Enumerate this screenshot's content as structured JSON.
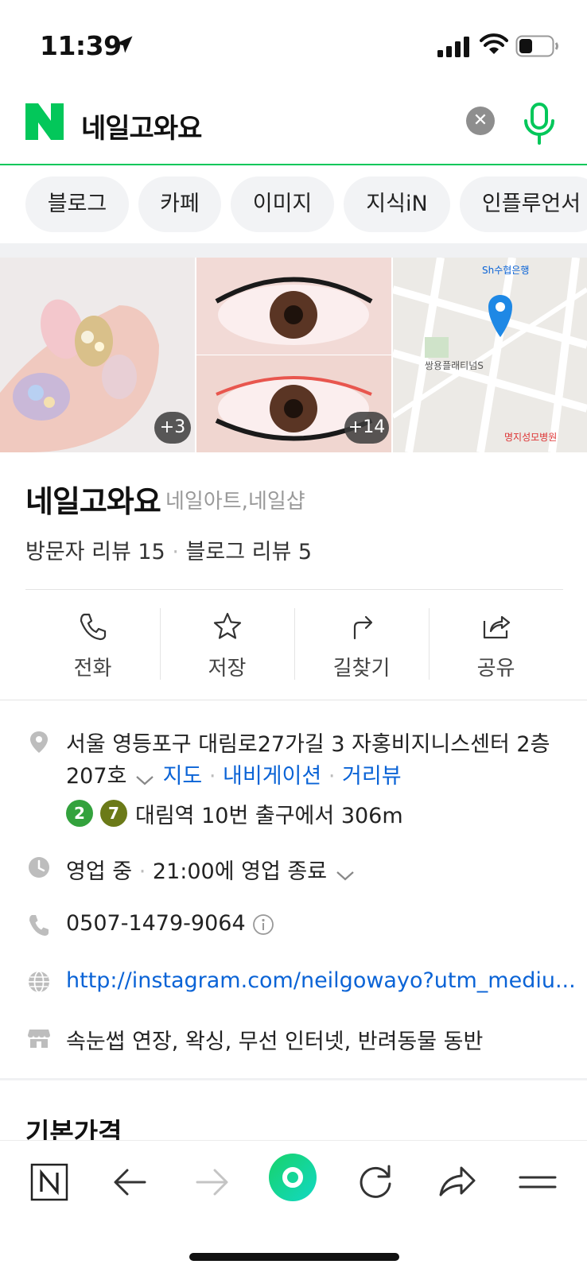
{
  "status": {
    "time": "11:39"
  },
  "search": {
    "query": "네일고와요"
  },
  "tabs": [
    "블로그",
    "카페",
    "이미지",
    "지식iN",
    "인플루언서"
  ],
  "photos": {
    "badge1": "+3",
    "badge2": "+14"
  },
  "place": {
    "name": "네일고와요",
    "category": "네일아트,네일샵",
    "visitor_reviews": "방문자 리뷰 15",
    "blog_reviews": "블로그 리뷰 5",
    "sep": "·"
  },
  "actions": {
    "call": "전화",
    "save": "저장",
    "directions": "길찾기",
    "share": "공유"
  },
  "info": {
    "address_line1": "서울 영등포구 대림로27가길 3 자홍비지니스센터 2층",
    "address_line2": "207호",
    "map": "지도",
    "navigation": "내비게이션",
    "street_view": "거리뷰",
    "subway_line_a": "2",
    "subway_line_b": "7",
    "subway": "대림역 10번 출구에서 306m",
    "hours_status": "영업 중",
    "hours_detail": "21:00에 영업 종료",
    "phone": "0507-1479-9064",
    "website": "http://instagram.com/neilgowayo?utm_mediu...",
    "amenities": "속눈썹 연장, 왁싱, 무선 인터넷, 반려동물 동반"
  },
  "section": {
    "title": "기본가격"
  },
  "colors": {
    "naver_green": "#03c75a",
    "link_blue": "#0a63d6",
    "line2": "#33a23d",
    "line7": "#6b7a18"
  }
}
